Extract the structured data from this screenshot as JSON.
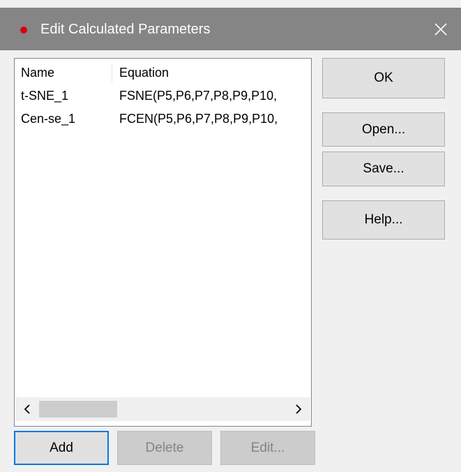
{
  "window": {
    "title": "Edit Calculated Parameters",
    "accent_color": "#d7000f",
    "titlebar_color": "#858585"
  },
  "list": {
    "columns": [
      "Name",
      "Equation"
    ],
    "rows": [
      {
        "name": "t-SNE_1",
        "equation": "FSNE(P5,P6,P7,P8,P9,P10,"
      },
      {
        "name": "Cen-se_1",
        "equation": "FCEN(P5,P6,P7,P8,P9,P10,"
      }
    ]
  },
  "buttons": {
    "ok": "OK",
    "open": "Open...",
    "save": "Save...",
    "help": "Help...",
    "add": "Add",
    "delete": "Delete",
    "edit": "Edit..."
  },
  "icons": {
    "close": "close-icon",
    "scroll_left": "chevron-left-icon",
    "scroll_right": "chevron-right-icon"
  }
}
